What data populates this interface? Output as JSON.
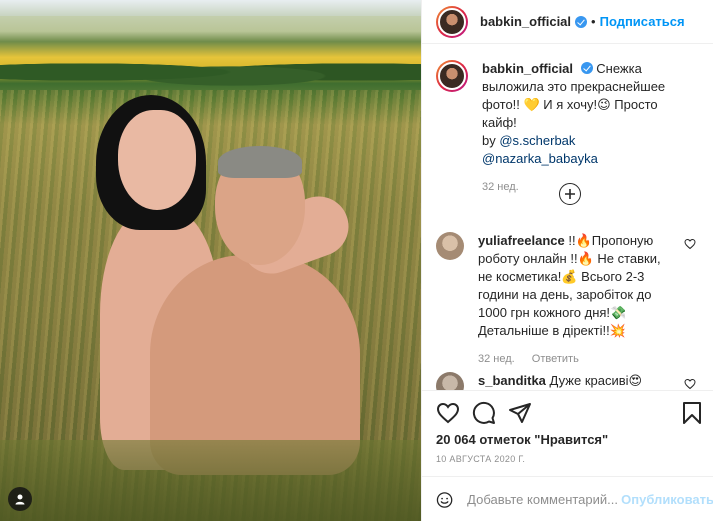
{
  "post": {
    "username": "babkin_official",
    "follow_label": "Подписаться",
    "dot": "•",
    "caption": {
      "text_1": "Снежка выложила это прекраснейшее фото!! 💛 И я хочу!😉 Просто кайф!",
      "by_prefix": "by",
      "mention_1": "@s.scherbak",
      "mention_2": "@nazarka_babayka",
      "time": "32 нед."
    },
    "comments": [
      {
        "username": "yuliafreelance",
        "text": "!!🔥Пропоную роботу онлайн !!🔥 Не ставки, не косметика!💰 Всього 2-3 години на день, заробіток до 1000 грн кожного дня!💸 Детальніше в діректі!!💥",
        "time": "32 нед.",
        "reply_label": "Ответить"
      },
      {
        "username": "s_banditka",
        "text": "Дуже красиві😍"
      }
    ],
    "likes": "20 064 отметок \"Нравится\"",
    "date": "10 АВГУСТА 2020 Г.",
    "comment_placeholder": "Добавьте комментарий...",
    "publish_label": "Опубликовать"
  },
  "colors": {
    "accent": "#0095f6",
    "muted": "#8e8e8e",
    "publish_disabled": "#b2dffc"
  },
  "icons": [
    "user-tag-icon",
    "verified-icon",
    "add-circle-icon",
    "heart-icon",
    "comment-icon",
    "share-icon",
    "bookmark-icon",
    "smile-icon"
  ]
}
